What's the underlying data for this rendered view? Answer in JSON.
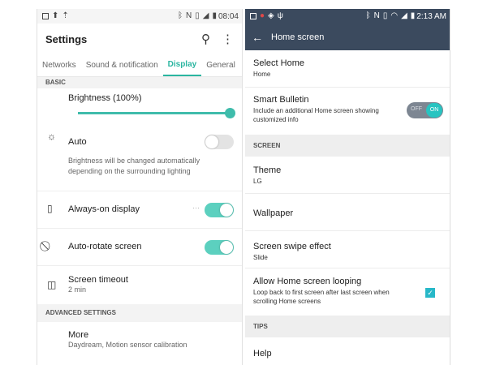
{
  "left": {
    "status": {
      "time": "08:04"
    },
    "appbar": {
      "title": "Settings",
      "search_icon": "⚲",
      "more_icon": "⋮"
    },
    "tabs": [
      "Networks",
      "Sound & notification",
      "Display",
      "General"
    ],
    "sections": {
      "basic": "BASIC",
      "advanced": "ADVANCED SETTINGS"
    },
    "brightness": {
      "label": "Brightness (100%)",
      "value": 100
    },
    "auto": {
      "label": "Auto",
      "desc": "Brightness will be changed automatically depending on the surrounding lighting",
      "on": false
    },
    "always_on": {
      "label": "Always-on display",
      "dots": "···",
      "on": true
    },
    "auto_rotate": {
      "label": "Auto-rotate screen",
      "on": true
    },
    "screen_timeout": {
      "label": "Screen timeout",
      "value": "2 min"
    },
    "more": {
      "label": "More",
      "sub": "Daydream, Motion sensor calibration"
    },
    "accent": "#2ab5a0"
  },
  "right": {
    "status": {
      "time": "2:13 AM"
    },
    "appbar": {
      "title": "Home screen",
      "back_icon": "←"
    },
    "select_home": {
      "label": "Select Home",
      "value": "Home"
    },
    "smart_bulletin": {
      "label": "Smart Bulletin",
      "desc": "Include an additional Home screen showing customized info",
      "off_label": "OFF",
      "on_label": "ON"
    },
    "sections": {
      "screen": "SCREEN",
      "tips": "TIPS"
    },
    "theme": {
      "label": "Theme",
      "value": "LG"
    },
    "wallpaper": {
      "label": "Wallpaper"
    },
    "swipe": {
      "label": "Screen swipe effect",
      "value": "Slide"
    },
    "looping": {
      "label": "Allow Home screen looping",
      "desc": "Loop back to first screen after last screen when scrolling Home screens",
      "checked": true,
      "check_glyph": "✓"
    },
    "help": {
      "label": "Help"
    },
    "accent": "#3b4a5e"
  }
}
